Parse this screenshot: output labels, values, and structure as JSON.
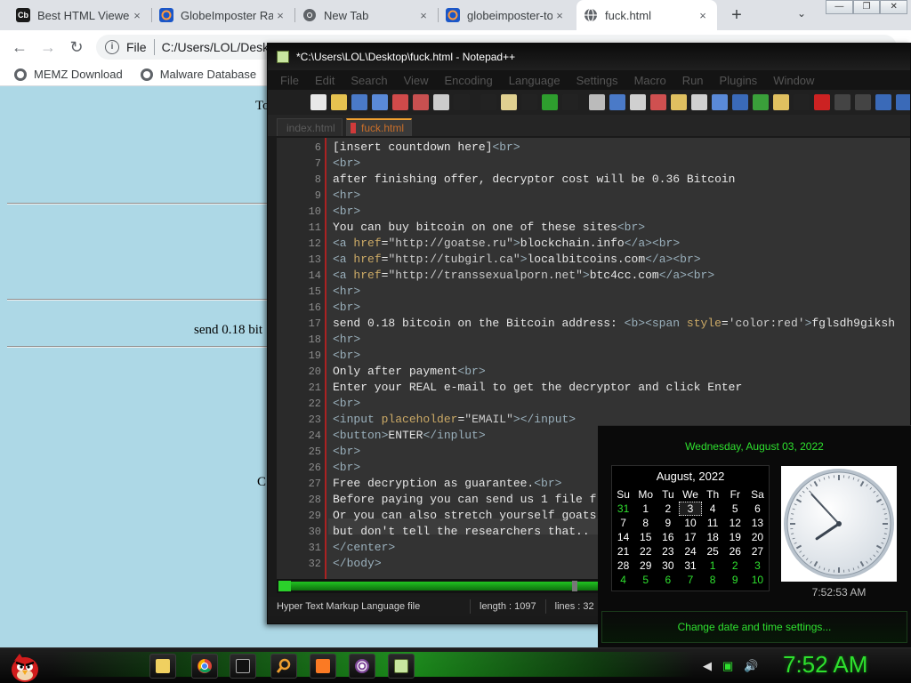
{
  "browser": {
    "tabs": [
      {
        "favicon": "cb-icon",
        "title": "Best HTML Viewer",
        "close": "×"
      },
      {
        "favicon": "globeimposter-icon",
        "title": "GlobeImposter Ra",
        "close": "×"
      },
      {
        "favicon": "chrome-icon",
        "title": "New Tab",
        "close": "×"
      },
      {
        "favicon": "globeimposter-icon",
        "title": "globeimposter-to",
        "close": "×"
      },
      {
        "favicon": "globe-icon",
        "title": "fuck.html",
        "close": "×"
      }
    ],
    "favicon_label": "Cb",
    "new_tab": "+",
    "tab_menu": "⌄",
    "window_controls": {
      "minimize": "—",
      "restore": "❐",
      "close": "✕"
    },
    "nav": {
      "back": "←",
      "forward": "→",
      "reload": "↻"
    },
    "address": {
      "scheme": "File",
      "path": "C:/Users/LOL/Deskt"
    },
    "bookmarks": [
      {
        "icon": "globe-icon",
        "label": "MEMZ Download"
      },
      {
        "icon": "globe-icon",
        "label": "Malware Database"
      }
    ]
  },
  "page": {
    "text_top": "To",
    "text_mid": "send 0.18 bit",
    "text_low": "C"
  },
  "npp": {
    "title": "*C:\\Users\\LOL\\Desktop\\fuck.html - Notepad++",
    "menu": [
      "File",
      "Edit",
      "Search",
      "View",
      "Encoding",
      "Language",
      "Settings",
      "Macro",
      "Run",
      "Plugins",
      "Window"
    ],
    "tabs": [
      "index.html",
      "fuck.html"
    ],
    "status": {
      "type": "Hyper Text Markup Language file",
      "length": "length : 1097",
      "lines": "lines : 32"
    }
  },
  "code_lines": [
    {
      "n": "6",
      "t": "[insert countdown here]<br>"
    },
    {
      "n": "7",
      "t": "<br>"
    },
    {
      "n": "8",
      "t": "after finishing offer, decryptor cost will be 0.36 Bitcoin"
    },
    {
      "n": "9",
      "t": "<hr>"
    },
    {
      "n": "10",
      "t": "<br>"
    },
    {
      "n": "11",
      "t": "You can buy bitcoin on one of these sites<br>"
    },
    {
      "n": "12",
      "t": "<a href=\"http://goatse.ru\">blockchain.info</a><br>"
    },
    {
      "n": "13",
      "t": "<a href=\"http://tubgirl.ca\">localbitcoins.com</a><br>"
    },
    {
      "n": "14",
      "t": "<a href=\"http://transsexualporn.net\">btc4cc.com</a><br>"
    },
    {
      "n": "15",
      "t": "<hr>"
    },
    {
      "n": "16",
      "t": "<br>"
    },
    {
      "n": "17",
      "t": "send 0.18 bitcoin on the Bitcoin address: <b><span style='color:red'>fglsdh9giksh"
    },
    {
      "n": "18",
      "t": "<hr>"
    },
    {
      "n": "19",
      "t": "<br>"
    },
    {
      "n": "20",
      "t": "Only after payment<br>"
    },
    {
      "n": "21",
      "t": "Enter your REAL e-mail to get the decryptor and click Enter"
    },
    {
      "n": "22",
      "t": "<br>"
    },
    {
      "n": "23",
      "t": "<input placeholder=\"EMAIL\"></input>"
    },
    {
      "n": "24",
      "t": "<button>ENTER</inplut>"
    },
    {
      "n": "25",
      "t": "<br>"
    },
    {
      "n": "26",
      "t": "<br>"
    },
    {
      "n": "27",
      "t": "Free decryption as guarantee.<br>"
    },
    {
      "n": "28",
      "t": "Before paying you can send us 1 file f"
    },
    {
      "n": "29",
      "t": "Or you can also stretch yourself goats"
    },
    {
      "n": "30",
      "t": "but don't tell the researchers that.."
    },
    {
      "n": "31",
      "t": "</center>"
    },
    {
      "n": "32",
      "t": "</body>"
    }
  ],
  "clock": {
    "long_date": "Wednesday, August 03, 2022",
    "month": "August, 2022",
    "weekdays": [
      "Su",
      "Mo",
      "Tu",
      "We",
      "Th",
      "Fr",
      "Sa"
    ],
    "days": [
      {
        "d": "31",
        "o": true
      },
      {
        "d": "1"
      },
      {
        "d": "2"
      },
      {
        "d": "3",
        "today": true
      },
      {
        "d": "4"
      },
      {
        "d": "5"
      },
      {
        "d": "6"
      },
      {
        "d": "7"
      },
      {
        "d": "8"
      },
      {
        "d": "9"
      },
      {
        "d": "10"
      },
      {
        "d": "11"
      },
      {
        "d": "12"
      },
      {
        "d": "13"
      },
      {
        "d": "14"
      },
      {
        "d": "15"
      },
      {
        "d": "16"
      },
      {
        "d": "17"
      },
      {
        "d": "18"
      },
      {
        "d": "19"
      },
      {
        "d": "20"
      },
      {
        "d": "21"
      },
      {
        "d": "22"
      },
      {
        "d": "23"
      },
      {
        "d": "24"
      },
      {
        "d": "25"
      },
      {
        "d": "26"
      },
      {
        "d": "27"
      },
      {
        "d": "28"
      },
      {
        "d": "29"
      },
      {
        "d": "30"
      },
      {
        "d": "31"
      },
      {
        "d": "1",
        "o": true
      },
      {
        "d": "2",
        "o": true
      },
      {
        "d": "3",
        "o": true
      },
      {
        "d": "4",
        "o": true
      },
      {
        "d": "5",
        "o": true
      },
      {
        "d": "6",
        "o": true
      },
      {
        "d": "7",
        "o": true
      },
      {
        "d": "8",
        "o": true
      },
      {
        "d": "9",
        "o": true
      },
      {
        "d": "10",
        "o": true
      }
    ],
    "analog_time": "7:52:53 AM",
    "analog": {
      "hours": 7,
      "minutes": 52,
      "seconds": 53
    },
    "settings_link": "Change date and time settings...",
    "taskbar_time": "7:52 AM"
  },
  "taskbar": {
    "pinned": [
      "explorer-icon",
      "chrome-icon",
      "cmd-icon",
      "search-icon",
      "xampp-icon",
      "tor-icon",
      "notepadpp-icon"
    ],
    "tray": [
      "speaker-icon",
      "network-icon",
      "volume-icon"
    ],
    "tray_glyphs": [
      "◀",
      "▣",
      "🔊"
    ]
  },
  "colors": {
    "accent": "#2ee02e",
    "page_bg": "#add8e6",
    "editor_bg": "#333333"
  }
}
